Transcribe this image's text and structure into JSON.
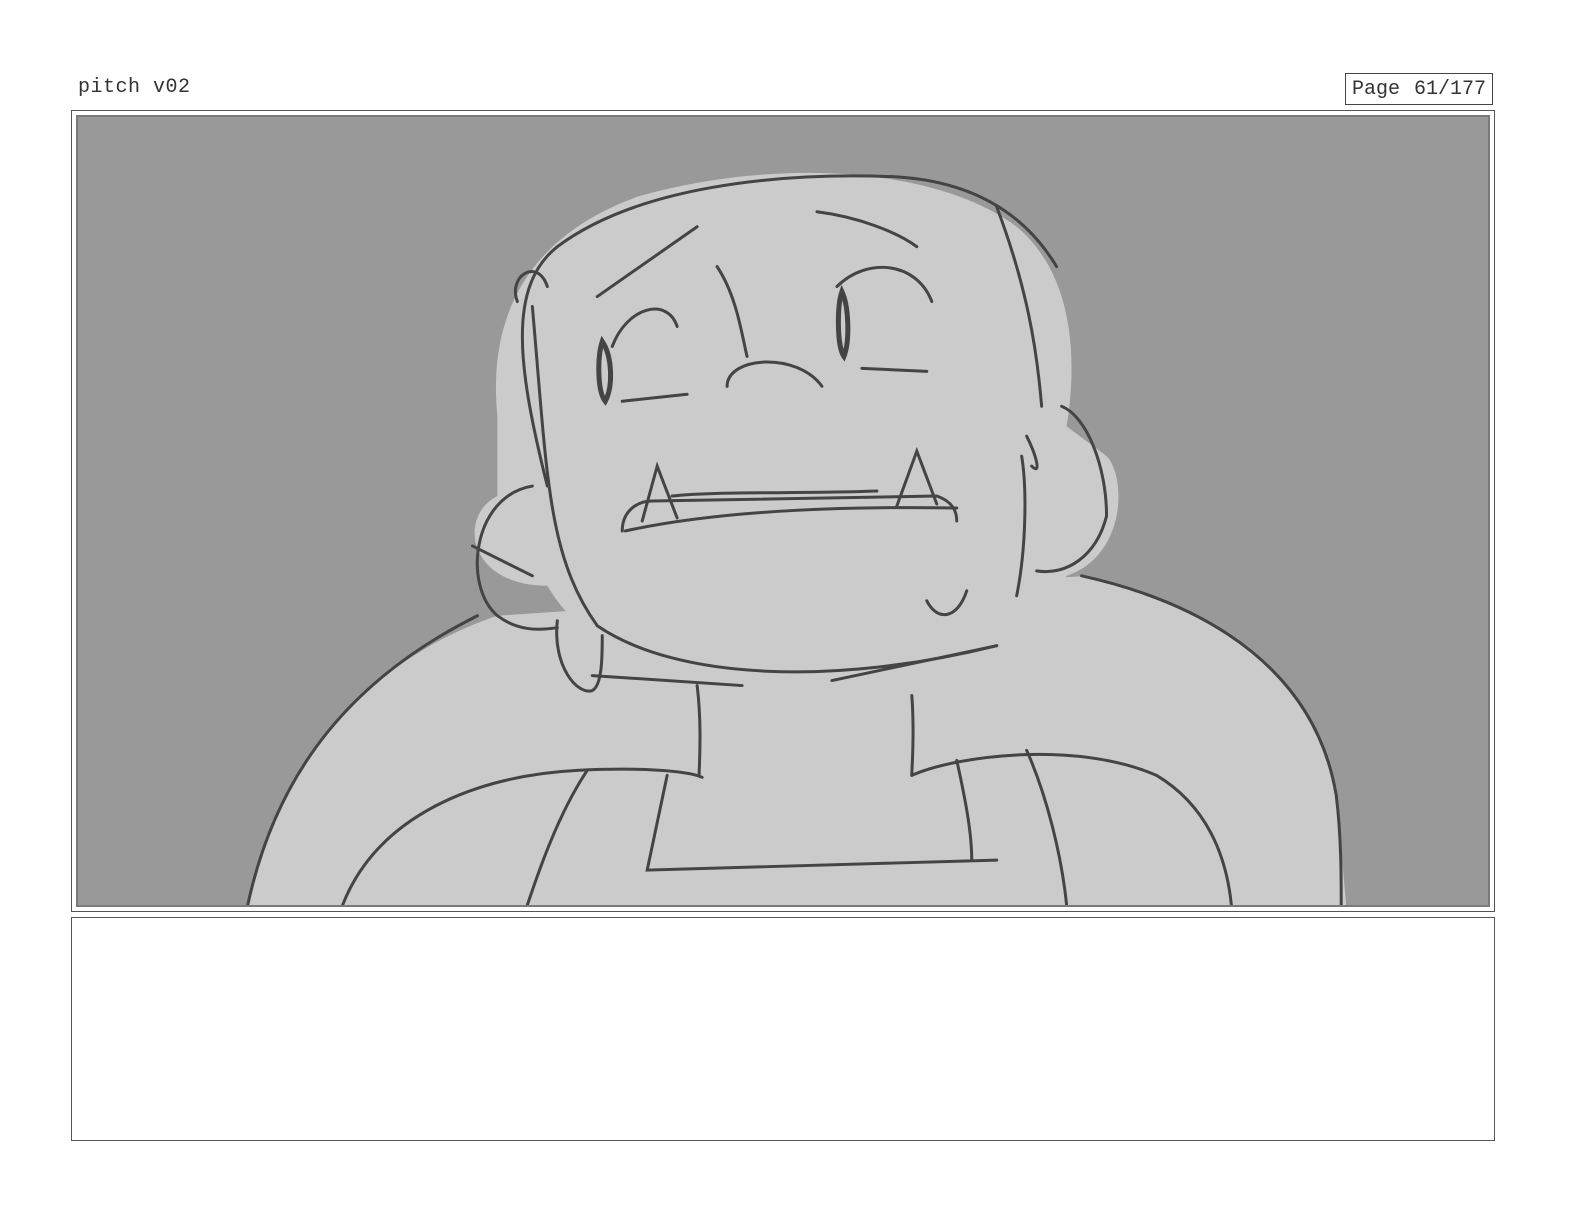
{
  "header": {
    "title": "pitch v02",
    "page_label": "Page",
    "page_number": "61/177"
  },
  "panel": {
    "drawing": "storyboard-sketch"
  },
  "notes": {
    "text": ""
  },
  "colors": {
    "background": "#999999",
    "fill": "#cccccc",
    "line": "#444444"
  }
}
